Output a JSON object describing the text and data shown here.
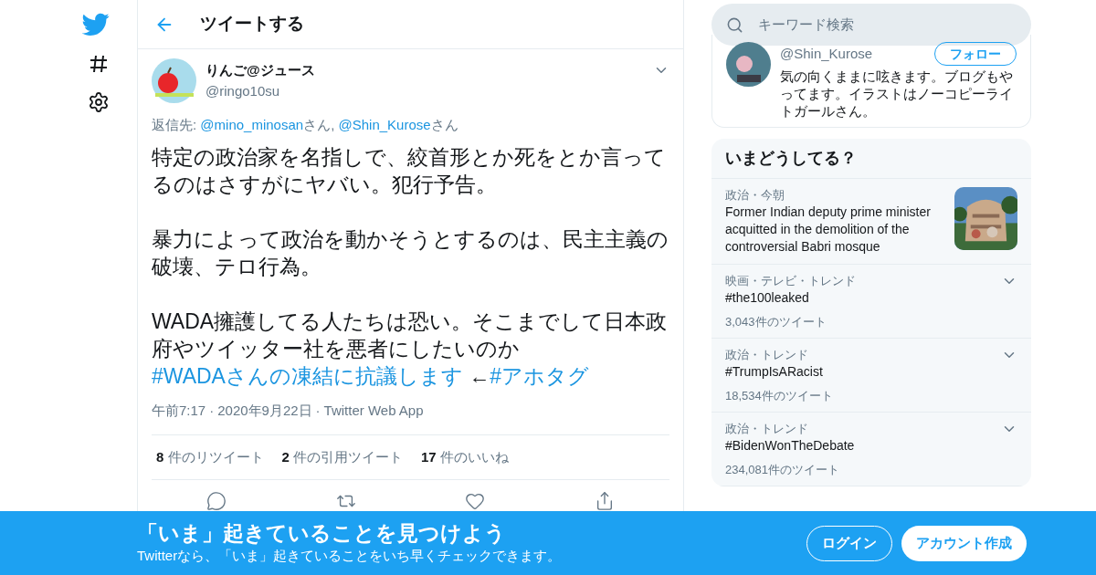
{
  "header": {
    "title": "ツイートする"
  },
  "tweet": {
    "name": "りんご@ジュース",
    "handle": "@ringo10su",
    "reply_to": [
      {
        "kind": "text",
        "text": "返信先: "
      },
      {
        "kind": "link",
        "text": "@mino_minosan"
      },
      {
        "kind": "text",
        "text": "さん, "
      },
      {
        "kind": "link",
        "text": "@Shin_Kurose"
      },
      {
        "kind": "text",
        "text": "さん"
      }
    ],
    "paragraphs": [
      [
        {
          "kind": "text",
          "text": "特定の政治家を名指しで、絞首形とか死をとか言ってるのはさすがにヤバい。犯行予告。"
        }
      ],
      [
        {
          "kind": "text",
          "text": "暴力によって政治を動かそうとするのは、民主主義の破壊、テロ行為。"
        }
      ],
      [
        {
          "kind": "text",
          "text": "WADA擁護してる人たちは恐い。そこまでして日本政府やツイッター社を悪者にしたいのか"
        },
        {
          "kind": "break"
        },
        {
          "kind": "link",
          "text": "#WADAさんの凍結に抗議します"
        },
        {
          "kind": "text",
          "text": " ←"
        },
        {
          "kind": "link",
          "text": "#アホタグ"
        }
      ]
    ],
    "meta": [
      "午前7:17",
      "2020年9月22日",
      "Twitter Web App"
    ],
    "meta_separator": "·",
    "stats": [
      {
        "count": "8",
        "label": "件のリツイート"
      },
      {
        "count": "2",
        "label": "件の引用ツイート"
      },
      {
        "count": "17",
        "label": "件のいいね"
      }
    ]
  },
  "search": {
    "placeholder": "キーワード検索"
  },
  "profile": {
    "handle": "@Shin_Kurose",
    "follow": "フォロー",
    "bio": "気の向くままに呟きます。ブログもやってます。イラストはノーコピーライトガールさん。"
  },
  "trends": {
    "title": "いまどうしてる？",
    "items": [
      {
        "kind": "news",
        "category": "政治・今朝",
        "title": "Former Indian deputy prime minister acquitted in the demolition of the controversial Babri mosque"
      },
      {
        "kind": "trend",
        "category": "映画・テレビ・トレンド",
        "title": "#the100leaked",
        "count": "3,043件のツイート"
      },
      {
        "kind": "trend",
        "category": "政治・トレンド",
        "title": "#TrumpIsARacist",
        "count": "18,534件のツイート"
      },
      {
        "kind": "trend",
        "category": "政治・トレンド",
        "title": "#BidenWonTheDebate",
        "count": "234,081件のツイート"
      }
    ]
  },
  "banner": {
    "title": "「いま」起きていることを見つけよう",
    "subtitle": "Twitterなら、「いま」起きていることをいち早くチェックできます。",
    "login": "ログイン",
    "signup": "アカウント作成"
  }
}
